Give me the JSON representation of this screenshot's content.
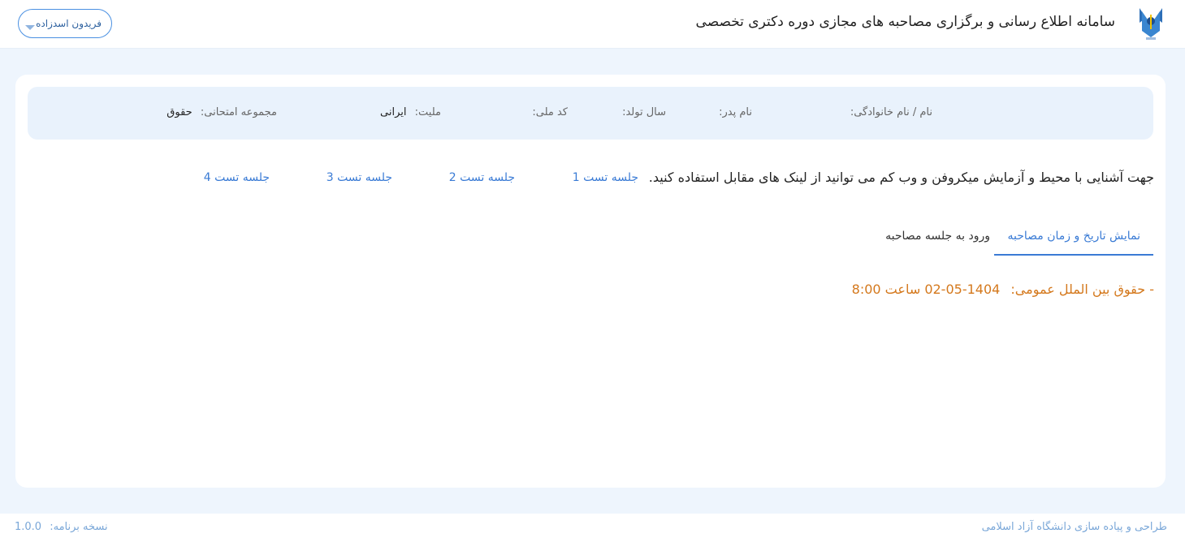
{
  "header": {
    "title": "سامانه اطلاع رسانی و برگزاری مصاحبه های مجازی دوره دکتری تخصصی",
    "logo_icon": "university-logo-icon",
    "user_name": "فریدون اسدزاده",
    "user_menu_icon": "chevron-down-icon"
  },
  "info": {
    "full_name_label": "نام / نام خانوادگی:",
    "full_name_value": "",
    "father_label": "نام پدر:",
    "father_value": "",
    "birth_year_label": "سال تولد:",
    "birth_year_value": "",
    "national_code_label": "کد ملی:",
    "national_code_value": "",
    "nationality_label": "ملیت:",
    "nationality_value": "ایرانی",
    "exam_group_label": "مجموعه امتحانی:",
    "exam_group_value": "حقوق"
  },
  "intro": {
    "text": "جهت آشنایی با محیط و آزمایش میکروفن و وب کم می توانید از لینک های مقابل استفاده کنید.",
    "links": [
      "جلسه تست 1",
      "جلسه تست 2",
      "جلسه تست 3",
      "جلسه تست 4"
    ]
  },
  "tabs": {
    "schedule": "نمایش تاریخ و زمان مصاحبه",
    "enter": "ورود به جلسه مصاحبه",
    "active": "schedule"
  },
  "schedule": {
    "prefix": "- حقوق بین الملل عمومی:",
    "datetime": "1404-05-02 ساعت 8:00"
  },
  "footer": {
    "credit": "طراحی و پیاده سازی دانشگاه آزاد اسلامی",
    "version_label": "نسخه برنامه:",
    "version_value": "1.0.0"
  },
  "colors": {
    "accent": "#3a7bd5",
    "schedule_text": "#d4781c",
    "page_bg": "#eef5fd",
    "info_strip_bg": "#e9f2fc"
  }
}
